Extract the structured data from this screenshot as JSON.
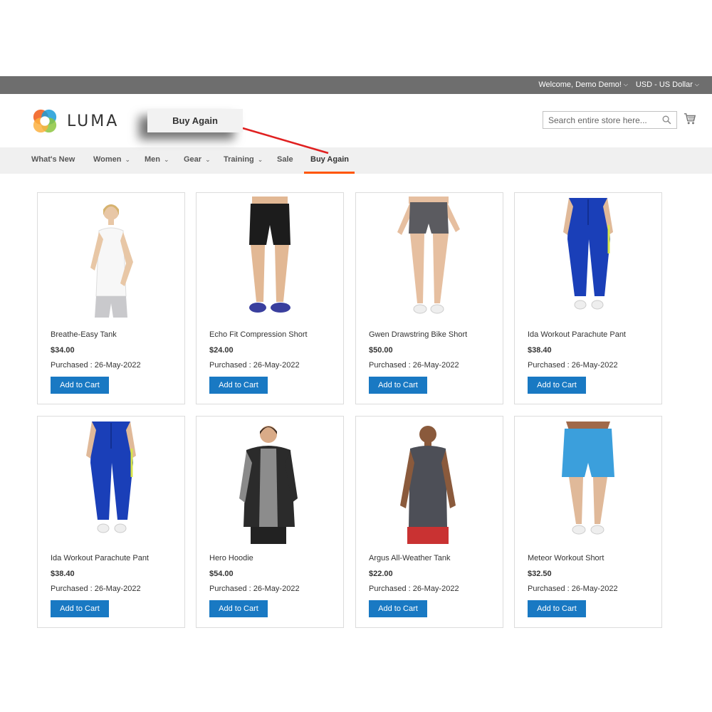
{
  "topbar": {
    "welcome": "Welcome, Demo Demo!",
    "currency": "USD - US Dollar"
  },
  "logo": {
    "text": "LUMA"
  },
  "callout": {
    "label": "Buy Again"
  },
  "search": {
    "placeholder": "Search entire store here..."
  },
  "nav": {
    "items": [
      {
        "label": "What's New"
      },
      {
        "label": "Women"
      },
      {
        "label": "Men"
      },
      {
        "label": "Gear"
      },
      {
        "label": "Training"
      },
      {
        "label": "Sale"
      },
      {
        "label": "Buy Again"
      }
    ],
    "active_color": "#ff5501"
  },
  "products": [
    {
      "name": "Breathe-Easy Tank",
      "price": "$34.00",
      "purchased": "Purchased : 26-May-2022",
      "button": "Add to Cart"
    },
    {
      "name": "Echo Fit Compression Short",
      "price": "$24.00",
      "purchased": "Purchased : 26-May-2022",
      "button": "Add to Cart"
    },
    {
      "name": "Gwen Drawstring Bike Short",
      "price": "$50.00",
      "purchased": "Purchased : 26-May-2022",
      "button": "Add to Cart"
    },
    {
      "name": "Ida Workout Parachute Pant",
      "price": "$38.40",
      "purchased": "Purchased : 26-May-2022",
      "button": "Add to Cart"
    },
    {
      "name": "Ida Workout Parachute Pant",
      "price": "$38.40",
      "purchased": "Purchased : 26-May-2022",
      "button": "Add to Cart"
    },
    {
      "name": "Hero Hoodie",
      "price": "$54.00",
      "purchased": "Purchased : 26-May-2022",
      "button": "Add to Cart"
    },
    {
      "name": "Argus All-Weather Tank",
      "price": "$22.00",
      "purchased": "Purchased : 26-May-2022",
      "button": "Add to Cart"
    },
    {
      "name": "Meteor Workout Short",
      "price": "$32.50",
      "purchased": "Purchased : 26-May-2022",
      "button": "Add to Cart"
    }
  ],
  "colors": {
    "topbar": "#6e6e6e",
    "nav_bg": "#f0f0f0",
    "button": "#1979c3",
    "annotation_line": "#e02020"
  }
}
